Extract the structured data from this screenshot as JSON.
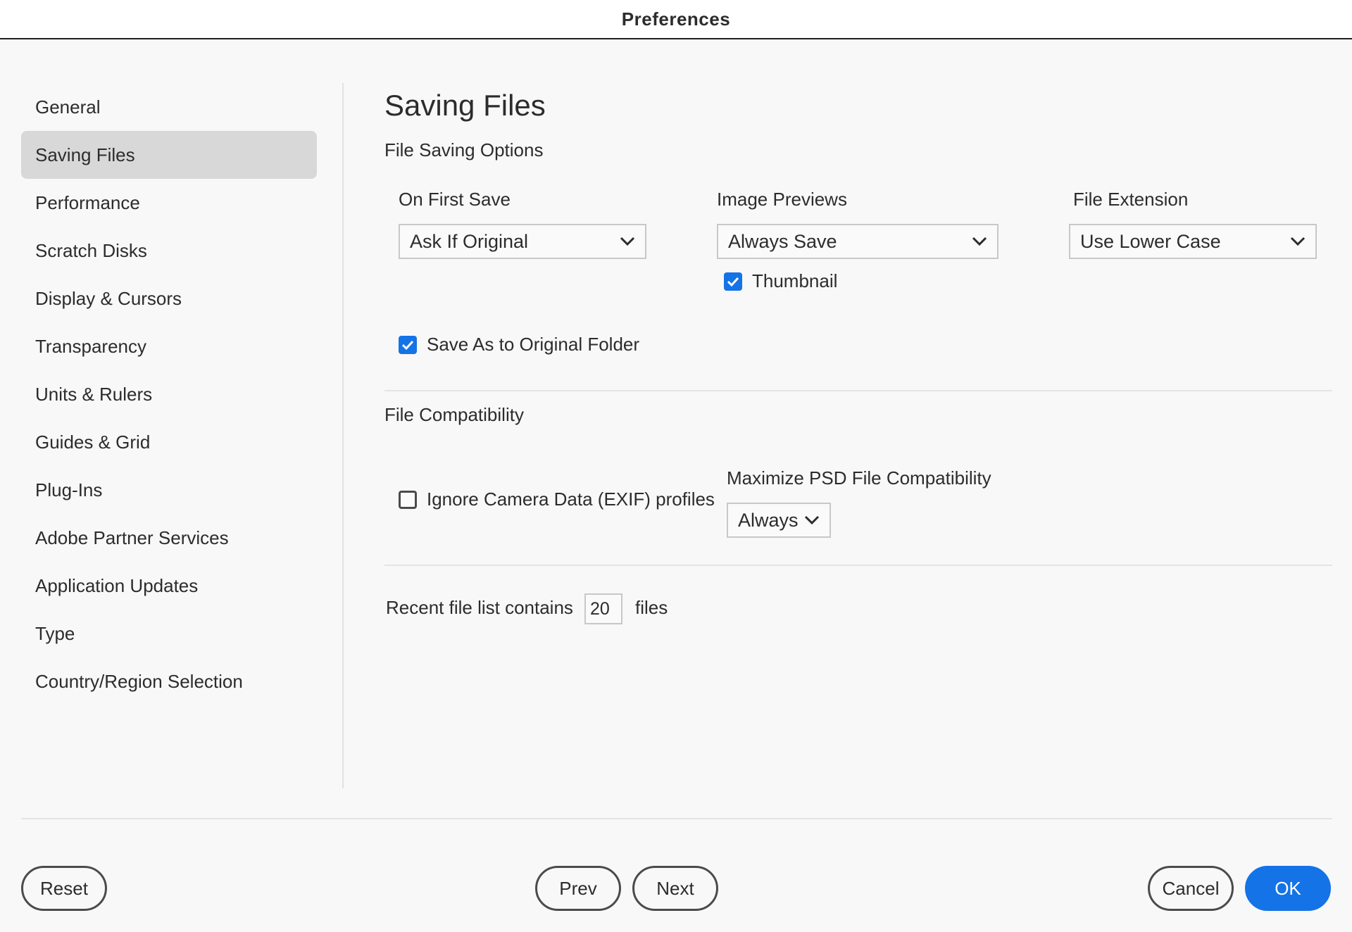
{
  "window": {
    "title": "Preferences"
  },
  "sidebar": {
    "items": [
      {
        "label": "General",
        "active": false
      },
      {
        "label": "Saving Files",
        "active": true
      },
      {
        "label": "Performance",
        "active": false
      },
      {
        "label": "Scratch Disks",
        "active": false
      },
      {
        "label": "Display & Cursors",
        "active": false
      },
      {
        "label": "Transparency",
        "active": false
      },
      {
        "label": "Units & Rulers",
        "active": false
      },
      {
        "label": "Guides & Grid",
        "active": false
      },
      {
        "label": "Plug-Ins",
        "active": false
      },
      {
        "label": "Adobe Partner Services",
        "active": false
      },
      {
        "label": "Application Updates",
        "active": false
      },
      {
        "label": "Type",
        "active": false
      },
      {
        "label": "Country/Region Selection",
        "active": false
      }
    ]
  },
  "main": {
    "title": "Saving Files",
    "file_saving_options": {
      "heading": "File Saving Options",
      "on_first_save": {
        "label": "On First Save",
        "value": "Ask If Original"
      },
      "image_previews": {
        "label": "Image Previews",
        "value": "Always Save"
      },
      "file_extension": {
        "label": "File Extension",
        "value": "Use Lower Case"
      },
      "thumbnail": {
        "label": "Thumbnail",
        "checked": true
      },
      "save_as_original_folder": {
        "label": "Save As to Original Folder",
        "checked": true
      }
    },
    "file_compatibility": {
      "heading": "File Compatibility",
      "ignore_exif": {
        "label": "Ignore Camera Data (EXIF) profiles",
        "checked": false
      },
      "maximize_psd": {
        "label": "Maximize PSD File Compatibility",
        "value": "Always"
      }
    },
    "recent_files": {
      "prefix": "Recent file list contains",
      "value": "20",
      "suffix": "files"
    }
  },
  "footer": {
    "reset": "Reset",
    "prev": "Prev",
    "next": "Next",
    "cancel": "Cancel",
    "ok": "OK"
  },
  "colors": {
    "accent": "#1473e6",
    "background": "#f8f8f8",
    "sidebar_active": "#d8d8d8"
  }
}
